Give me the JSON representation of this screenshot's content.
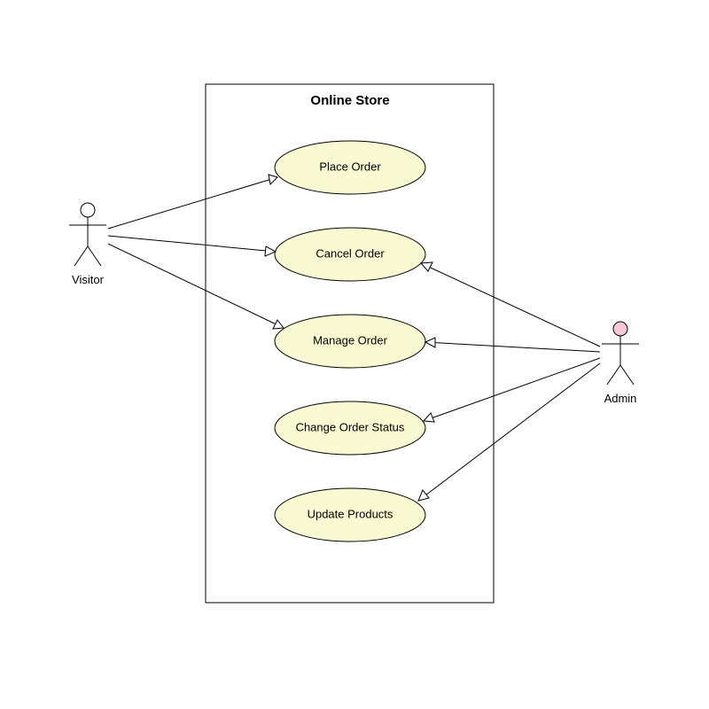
{
  "system": {
    "title": "Online Store"
  },
  "actors": {
    "left": {
      "name": "Visitor"
    },
    "right": {
      "name": "Admin"
    }
  },
  "usecases": [
    {
      "label": "Place Order"
    },
    {
      "label": "Cancel Order"
    },
    {
      "label": "Manage Order"
    },
    {
      "label": "Change Order Status"
    },
    {
      "label": "Update Products"
    }
  ],
  "colors": {
    "usecaseFill": "#fafad2",
    "adminHeadFill": "#f8c8d8",
    "visitorHeadFill": "#ffffff"
  }
}
